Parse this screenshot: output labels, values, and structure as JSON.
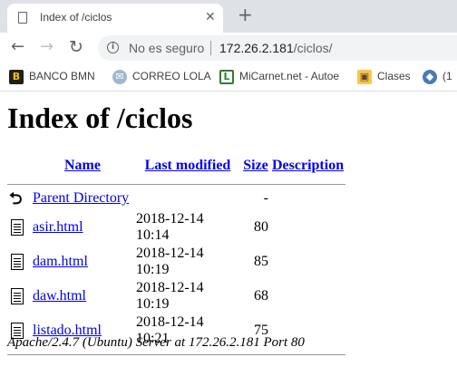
{
  "browser": {
    "tab_title": "Index of /ciclos",
    "tab_close": "✕",
    "new_tab": "+",
    "security_label": "No es seguro",
    "url_host": "172.26.2.181",
    "url_path": "/ciclos/"
  },
  "bookmarks": [
    {
      "label": "BANCO BMN",
      "icon": "B"
    },
    {
      "label": "CORREO LOLA",
      "icon": "✉"
    },
    {
      "label": "MiCarnet.net - Autoe",
      "icon": "L"
    },
    {
      "label": "Clases",
      "icon": "▣"
    },
    {
      "label": "(1",
      "icon": "◆"
    }
  ],
  "page": {
    "title": "Index of /ciclos",
    "columns": {
      "name": "Name",
      "modified": "Last modified",
      "size": "Size",
      "description": "Description"
    },
    "parent": {
      "name": "Parent Directory",
      "size": "-"
    },
    "rows": [
      {
        "name": "asir.html",
        "modified": "2018-12-14 10:14",
        "size": "80"
      },
      {
        "name": "dam.html",
        "modified": "2018-12-14 10:19",
        "size": "85"
      },
      {
        "name": "daw.html",
        "modified": "2018-12-14 10:19",
        "size": "68"
      },
      {
        "name": "listado.html",
        "modified": "2018-12-14 10:21",
        "size": "75"
      }
    ],
    "footer": "Apache/2.4.7 (Ubuntu) Server at 172.26.2.181 Port 80"
  }
}
